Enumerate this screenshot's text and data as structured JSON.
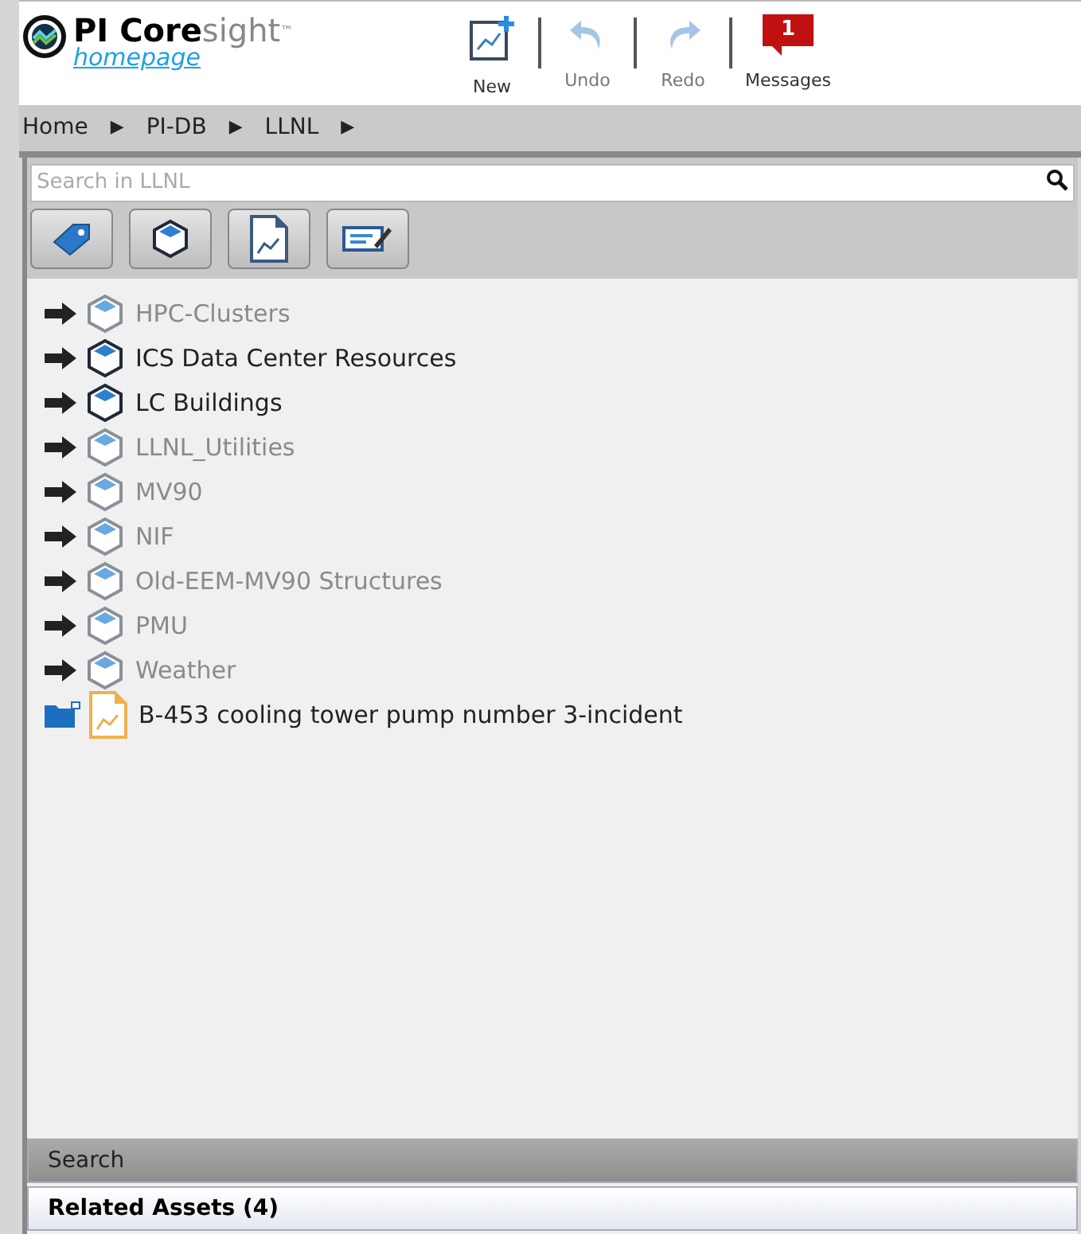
{
  "header": {
    "logo_bold": "PI Core",
    "logo_light": "sight",
    "trademark": "™",
    "link": "homepage"
  },
  "toolbar": [
    {
      "kind": "new",
      "label": "New",
      "disabled": false
    },
    {
      "kind": "undo",
      "label": "Undo",
      "disabled": true
    },
    {
      "kind": "redo",
      "label": "Redo",
      "disabled": true
    },
    {
      "kind": "messages",
      "label": "Messages",
      "badge": "1",
      "disabled": false
    }
  ],
  "breadcrumb": [
    "Home",
    "PI-DB",
    "LLNL"
  ],
  "breadcrumb_separator": "▶",
  "search": {
    "placeholder": "Search in LLNL"
  },
  "filters": [
    {
      "kind": "tag"
    },
    {
      "kind": "element"
    },
    {
      "kind": "display"
    },
    {
      "kind": "edit"
    }
  ],
  "tree": [
    {
      "kind": "element",
      "label": "HPC-Clusters",
      "emphasized": false
    },
    {
      "kind": "element",
      "label": "ICS Data Center Resources",
      "emphasized": true
    },
    {
      "kind": "element",
      "label": "LC Buildings",
      "emphasized": true
    },
    {
      "kind": "element",
      "label": "LLNL_Utilities",
      "emphasized": false
    },
    {
      "kind": "element",
      "label": "MV90",
      "emphasized": false
    },
    {
      "kind": "element",
      "label": "NIF",
      "emphasized": false
    },
    {
      "kind": "element",
      "label": "Old-EEM-MV90 Structures",
      "emphasized": false
    },
    {
      "kind": "element",
      "label": "PMU",
      "emphasized": false
    },
    {
      "kind": "element",
      "label": "Weather",
      "emphasized": false
    },
    {
      "kind": "display",
      "label": "B-453 cooling tower pump number 3-incident",
      "emphasized": true
    }
  ],
  "panels": [
    {
      "label": "Search",
      "selected": false
    },
    {
      "label": "Related Assets (4)",
      "selected": true
    }
  ]
}
